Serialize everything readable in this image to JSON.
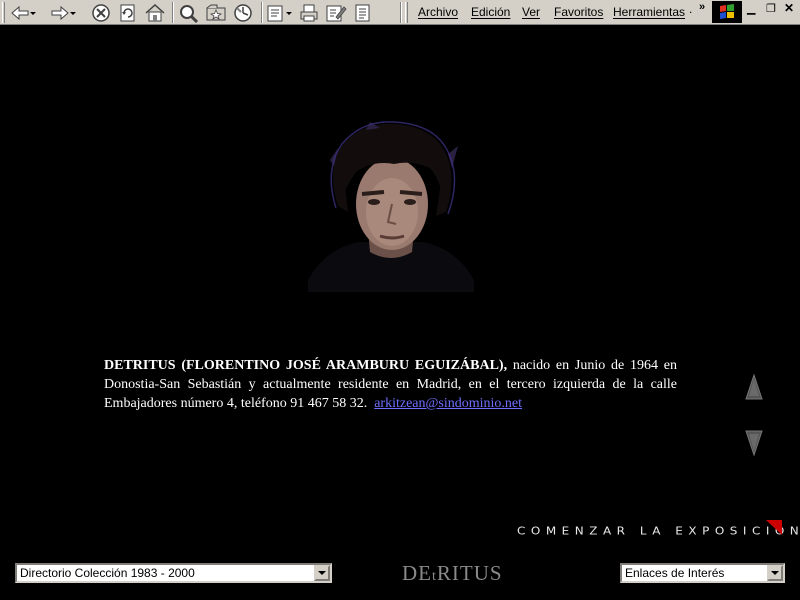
{
  "menu": {
    "items": [
      "Archivo",
      "Edición",
      "Ver",
      "Favoritos",
      "Herramientas"
    ],
    "more": "."
  },
  "bio": {
    "name": "DETRITUS (FLORENTINO JOSÉ ARAMBURU EGUIZÁBAL),",
    "text": " nacido en Junio de 1964 en Donostia-San Sebastián y actualmente residente en Madrid, en el tercero izquierda de la calle Embajadores número 4, teléfono 91 467 58 32.",
    "email": "arkitzean@sindominio.net"
  },
  "start_link": "COMENZAR LA EXPOSICIÓN",
  "directory_select": {
    "selected": "Directorio Colección 1983 - 2000"
  },
  "brand": {
    "big_d": "DE",
    "small": "t",
    "rest": "RITUS"
  },
  "links_select": {
    "selected": "Enlaces de Interés"
  },
  "colors": {
    "accent": "#cc0000",
    "link": "#6f6fff",
    "toolbar": "#d4d0c8"
  },
  "icons": [
    "back-arrow-icon",
    "forward-arrow-icon",
    "stop-icon",
    "refresh-icon",
    "home-icon",
    "search-icon",
    "favorites-icon",
    "history-icon",
    "mail-icon",
    "print-icon",
    "edit-icon",
    "discuss-icon",
    "windows-logo-icon",
    "arrow-up-icon",
    "arrow-down-icon"
  ]
}
